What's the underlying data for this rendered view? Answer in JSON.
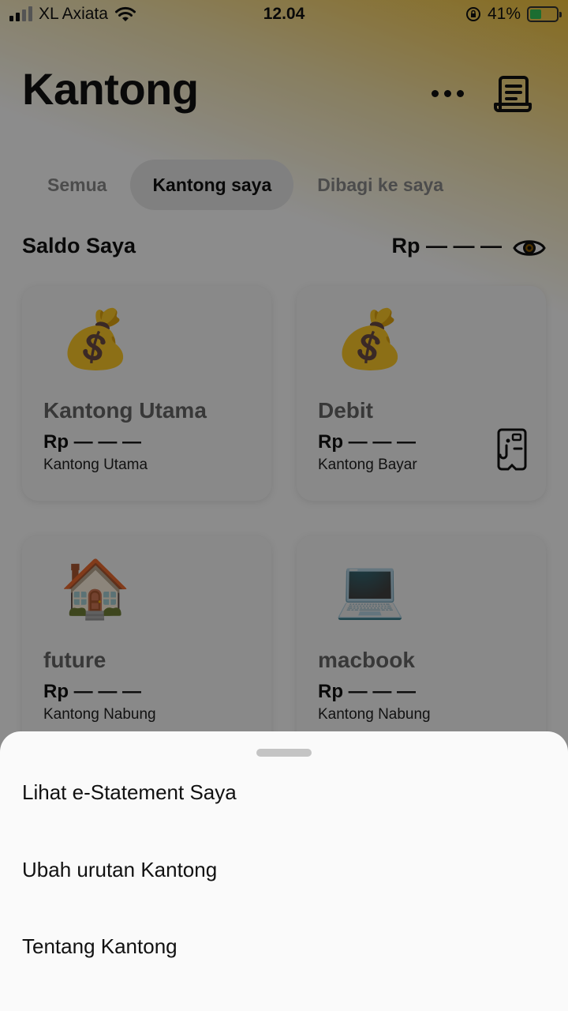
{
  "status_bar": {
    "carrier": "XL Axiata",
    "time": "12.04",
    "battery": "41%"
  },
  "header": {
    "title": "Kantong",
    "more_icon": "more-horizontal-icon",
    "receipt_icon": "receipt-icon"
  },
  "tabs": [
    {
      "label": "Semua",
      "active": false
    },
    {
      "label": "Kantong saya",
      "active": true
    },
    {
      "label": "Dibagi ke saya",
      "active": false
    }
  ],
  "balance": {
    "label": "Saldo Saya",
    "value": "Rp — — —",
    "eye_icon": "eye-icon"
  },
  "pockets": [
    {
      "emoji": "💰",
      "name": "Kantong Utama",
      "amount": "Rp — — —",
      "type": "Kantong Utama"
    },
    {
      "emoji": "💰",
      "name": "Debit",
      "amount": "Rp — — —",
      "type": "Kantong Bayar",
      "icon": "payment-card-icon"
    },
    {
      "emoji": "🏠",
      "name": "future",
      "amount": "Rp — — —",
      "type": "Kantong Nabung"
    },
    {
      "emoji": "💻",
      "name": "macbook",
      "amount": "Rp — — —",
      "type": "Kantong Nabung"
    }
  ],
  "sheet": {
    "items": [
      {
        "label": "Lihat e-Statement Saya"
      },
      {
        "label": "Ubah urutan Kantong"
      },
      {
        "label": "Tentang Kantong"
      }
    ]
  },
  "colors": {
    "accent_gradient": "#f6c53a",
    "overlay": "#000000",
    "battery_fill": "#34c759"
  }
}
